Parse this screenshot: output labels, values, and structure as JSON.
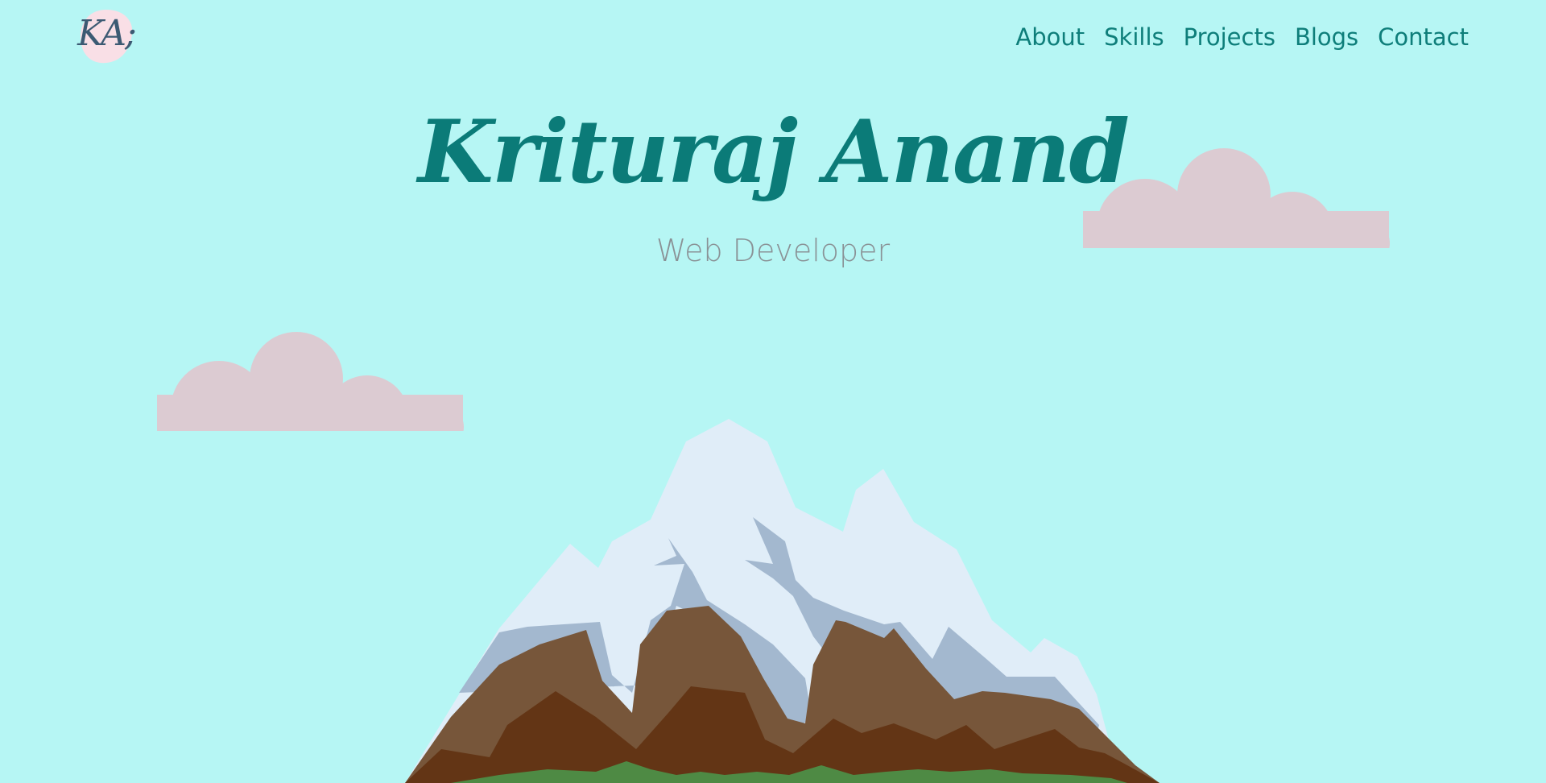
{
  "header": {
    "logo_text": "KA;",
    "nav": [
      {
        "label": "About"
      },
      {
        "label": "Skills"
      },
      {
        "label": "Projects"
      },
      {
        "label": "Blogs"
      },
      {
        "label": "Contact"
      }
    ]
  },
  "hero": {
    "name": "Krituraj Anand",
    "role": "Web Developer"
  },
  "colors": {
    "background": "#b6f6f4",
    "accent": "#0b7b78",
    "cloud": "#dccbd2",
    "snow": "#e0edf8",
    "snow_shadow": "#a3b8cf",
    "rock_light": "#77563a",
    "rock_dark": "#633515",
    "grass": "#4e8a44"
  }
}
